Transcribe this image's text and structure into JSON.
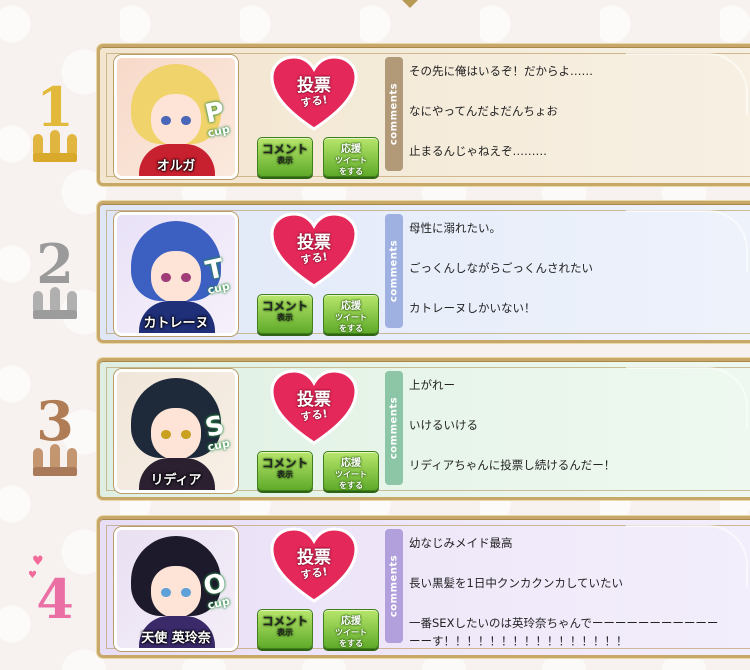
{
  "ranking": [
    {
      "rank": "1",
      "theme": {
        "card": "linear-gradient(90deg,#f3e6cf 0%,#f4ead8 40%,#f7f0e3 100%)",
        "tab": "#b29a78",
        "digit": "#e2b93a",
        "crown": "#e0b640",
        "portraitBg": "linear-gradient(135deg,#f7d9c9,#fbe9dd)",
        "hair": "#f0d36a",
        "eye": "#4a66b8",
        "body": "#c7202e",
        "cup": "#2a8a45"
      },
      "character": {
        "name": "オルガ",
        "cup_letter": "P",
        "cup_word": "cup"
      },
      "vote": {
        "line1": "投票",
        "line2": "する!"
      },
      "buttons": {
        "comment_l1": "コメント",
        "comment_l2": "表示",
        "cheer_l1": "応援",
        "cheer_l2": "ツイート",
        "cheer_l3": "をする"
      },
      "comments_tab": "comments",
      "comments": [
        "その先に俺はいるぞ！だからよ……",
        "なにやってんだよだんちょお",
        "止まるんじゃねえぞ………"
      ]
    },
    {
      "rank": "2",
      "theme": {
        "card": "linear-gradient(90deg,#dfe6f6 0%,#e8eefa 50%,#eef2fb 100%)",
        "tab": "#9fb1e0",
        "digit": "#9a9a9a",
        "crown": "#b0b0b0",
        "portraitBg": "linear-gradient(135deg,#e9e2f7,#f6f0fb)",
        "hair": "#3c5fc2",
        "eye": "#a03c78",
        "body": "#1f2f78",
        "cup": "#2a8a45"
      },
      "character": {
        "name": "カトレーヌ",
        "cup_letter": "T",
        "cup_word": "cup"
      },
      "vote": {
        "line1": "投票",
        "line2": "する!"
      },
      "buttons": {
        "comment_l1": "コメント",
        "comment_l2": "表示",
        "cheer_l1": "応援",
        "cheer_l2": "ツイート",
        "cheer_l3": "をする"
      },
      "comments_tab": "comments",
      "comments": [
        "母性に溺れたい。",
        "ごっくんしながらごっくんされたい",
        "カトレーヌしかいない！"
      ]
    },
    {
      "rank": "3",
      "theme": {
        "card": "linear-gradient(90deg,#dff0e3 0%,#e8f5ea 50%,#eef8f0 100%)",
        "tab": "#8cc6a6",
        "digit": "#b07c55",
        "crown": "#c39670",
        "portraitBg": "linear-gradient(135deg,#f0e6d9,#f8efe6)",
        "hair": "#1e2a3a",
        "eye": "#c9a020",
        "body": "#2a2030",
        "cup": "#2a8a45"
      },
      "character": {
        "name": "リディア",
        "cup_letter": "S",
        "cup_word": "cup"
      },
      "vote": {
        "line1": "投票",
        "line2": "する!"
      },
      "buttons": {
        "comment_l1": "コメント",
        "comment_l2": "表示",
        "cheer_l1": "応援",
        "cheer_l2": "ツイート",
        "cheer_l3": "をする"
      },
      "comments_tab": "comments",
      "comments": [
        "上がれー",
        "いけるいける",
        "リディアちゃんに投票し続けるんだー！"
      ]
    },
    {
      "rank": "4",
      "theme": {
        "card": "linear-gradient(90deg,#e8def6 0%,#efe8f9 50%,#f3eefb 100%)",
        "tab": "#b1a0dc",
        "digit": "#ea6fa5",
        "crown": "none",
        "portraitBg": "linear-gradient(135deg,#e9e0f2,#f4eef8)",
        "hair": "#1d1a2c",
        "eye": "#5ea0d8",
        "body": "#3a2a6a",
        "cup": "#2a8a45"
      },
      "character": {
        "name": "天使 英玲奈",
        "cup_letter": "O",
        "cup_word": "cup"
      },
      "vote": {
        "line1": "投票",
        "line2": "する!"
      },
      "buttons": {
        "comment_l1": "コメント",
        "comment_l2": "表示",
        "cheer_l1": "応援",
        "cheer_l2": "ツイート",
        "cheer_l3": "をする"
      },
      "comments_tab": "comments",
      "comments": [
        "幼なじみメイド最高",
        "長い黒髪を1日中クンカクンカしていたい",
        "一番SEXしたいのは英玲奈ちゃんでーーーーーーーーーーー",
        "ーーす！！！！！！！！！！！！！！！！"
      ]
    }
  ]
}
